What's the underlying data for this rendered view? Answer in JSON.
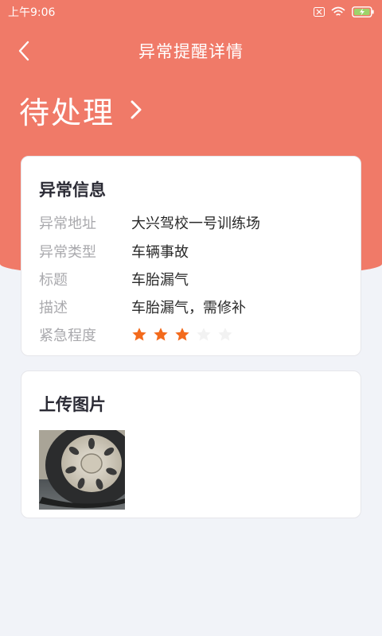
{
  "status_bar": {
    "time": "上午9:06"
  },
  "nav": {
    "title": "异常提醒详情"
  },
  "header": {
    "status": "待处理"
  },
  "info": {
    "title": "异常信息",
    "rows": [
      {
        "label": "异常地址",
        "value": "大兴驾校一号训练场"
      },
      {
        "label": "异常类型",
        "value": "车辆事故"
      },
      {
        "label": "标题",
        "value": "车胎漏气"
      },
      {
        "label": "描述",
        "value": "车胎漏气，需修补"
      }
    ],
    "urgency_label": "紧急程度",
    "urgency_rating": 3,
    "urgency_max": 5
  },
  "upload": {
    "title": "上传图片"
  },
  "colors": {
    "primary": "#f07a68",
    "star_on": "#f36a1c",
    "star_off": "#f2f2f2"
  }
}
